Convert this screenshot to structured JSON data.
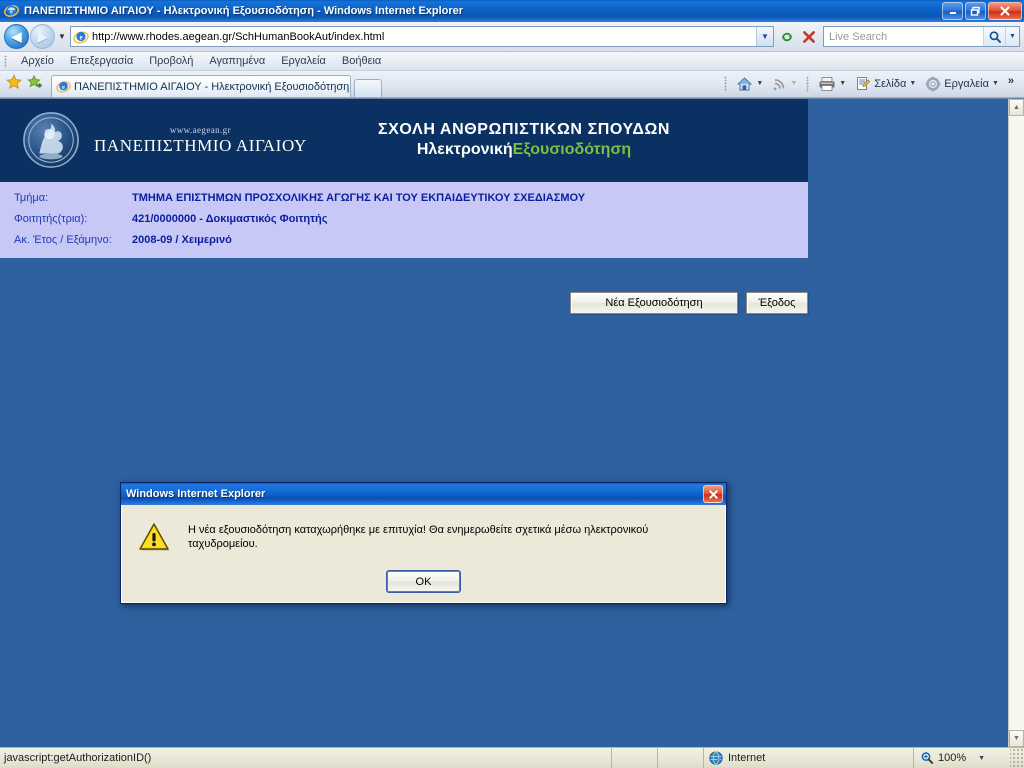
{
  "window": {
    "title": "ΠΑΝΕΠΙΣΤΗΜΙΟ ΑΙΓΑΙΟΥ - Ηλεκτρονική Εξουσιοδότηση - Windows Internet Explorer",
    "minimize_label": "Ελαχιστοποίηση",
    "restore_label": "Επαναφορά",
    "close_label": "Κλείσιμο"
  },
  "nav": {
    "back_label": "Πίσω",
    "forward_label": "Εμπρός",
    "recent_pages_label": "Πρόσφατες σελίδες",
    "address": "http://www.rhodes.aegean.gr/SchHumanBookAut/index.html",
    "refresh_label": "Ανανέωση",
    "stop_label": "Διακοπή"
  },
  "search": {
    "placeholder": "Live Search",
    "go_label": "Αναζήτηση",
    "dropdown_label": "Επιλογές αναζήτησης"
  },
  "menu": {
    "items": [
      {
        "label": "Αρχείο"
      },
      {
        "label": "Επεξεργασία"
      },
      {
        "label": "Προβολή"
      },
      {
        "label": "Αγαπημένα"
      },
      {
        "label": "Εργαλεία"
      },
      {
        "label": "Βοήθεια"
      }
    ]
  },
  "tabbar": {
    "favorites_center_label": "Κέντρο αγαπημένων",
    "add_favorite_label": "Προσθήκη στα αγαπημένα",
    "tabs": [
      {
        "title": "ΠΑΝΕΠΙΣΤΗΜΙΟ ΑΙΓΑΙΟΥ - Ηλεκτρονική Εξουσιοδότηση",
        "active": true
      }
    ],
    "new_tab_label": "Νέα καρτέλα",
    "right_tools": [
      {
        "label": "",
        "name": "home-button",
        "caret": true
      },
      {
        "label": "",
        "name": "feeds-button",
        "caret": true
      },
      {
        "label": "",
        "name": "print-button",
        "caret": true
      },
      {
        "label": "Σελίδα",
        "name": "page-menu-button",
        "caret": true
      },
      {
        "label": "Εργαλεία",
        "name": "tools-menu-button",
        "caret": true
      }
    ],
    "overflow_label": "»"
  },
  "page": {
    "header": {
      "www": "www.aegean.gr",
      "university": "ΠΑΝΕΠΙΣΤΗΜΙΟ ΑΙΓΑΙΟΥ",
      "school": "ΣΧΟΛΗ ΑΝΘΡΩΠΙΣΤΙΚΩΝ ΣΠΟΥΔΩΝ",
      "app_name_white": "Ηλεκτρονική",
      "app_name_green": "Εξουσιοδότηση"
    },
    "info": [
      {
        "label": "Τμήμα:",
        "value": "ΤΜΗΜΑ ΕΠΙΣΤΗΜΩΝ ΠΡΟΣΧΟΛΙΚΗΣ ΑΓΩΓΗΣ ΚΑΙ ΤΟΥ ΕΚΠΑΙΔΕΥΤΙΚΟΥ ΣΧΕΔΙΑΣΜΟΥ"
      },
      {
        "label": "Φοιτητής(τρια):",
        "value": "421/0000000 - Δοκιμαστικός Φοιτητής"
      },
      {
        "label": "Ακ. Έτος / Εξάμηνο:",
        "value": "2008-09 / Χειμερινό"
      }
    ],
    "buttons": {
      "new_authorization": "Νέα Εξουσιοδότηση",
      "exit": "Έξοδος"
    }
  },
  "dialog": {
    "title": "Windows Internet Explorer",
    "message": "Η νέα εξουσιοδότηση καταχωρήθηκε με επιτυχία! Θα ενημερωθείτε σχετικά μέσω ηλεκτρονικού ταχυδρομείου.",
    "ok_label": "OK",
    "close_label": "Κλείσιμο",
    "icon": "warning-triangle-icon"
  },
  "statusbar": {
    "message": "javascript:getAuthorizationID()",
    "zone": "Internet",
    "zoom": "100%"
  },
  "colors": {
    "page_background": "#2e5f9e",
    "header_background": "#0a3161",
    "info_panel_background": "#c8c8f7",
    "accent_green": "#76c043",
    "label_blue": "#1d3bb5",
    "value_blue": "#0b1f9e",
    "dialog_face": "#ece9d8",
    "titlebar_blue": "#0a58c8"
  }
}
